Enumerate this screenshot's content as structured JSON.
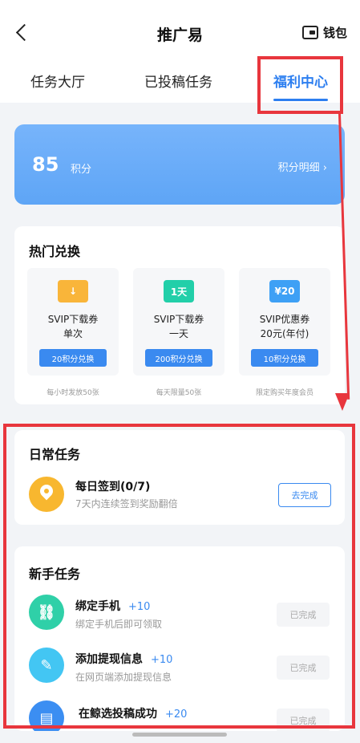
{
  "header": {
    "title": "推广易",
    "wallet_label": "钱包"
  },
  "tabs": [
    {
      "label": "任务大厅",
      "active": false
    },
    {
      "label": "已投稿任务",
      "active": false
    },
    {
      "label": "福利中心",
      "active": true
    }
  ],
  "points": {
    "value": "85",
    "unit": "积分",
    "detail_label": "积分明细 ›"
  },
  "hot_exchange": {
    "title": "热门兑换",
    "items": [
      {
        "icon": "download-coupon-icon",
        "icon_text": "↓",
        "icon_color": "#f9b53a",
        "name": "SVIP下载券",
        "sub": "单次",
        "button": "20积分兑换",
        "note": "每小时发放50张"
      },
      {
        "icon": "day-coupon-icon",
        "icon_text": "1天",
        "icon_color": "#22cfa9",
        "name": "SVIP下载券",
        "sub": "一天",
        "button": "200积分兑换",
        "note": "每天限量50张"
      },
      {
        "icon": "discount-coupon-icon",
        "icon_text": "¥20",
        "icon_color": "#3ea0f5",
        "name": "SVIP优惠券",
        "sub": "20元(年付)",
        "button": "10积分兑换",
        "note": "限定购买年度会员"
      }
    ]
  },
  "daily": {
    "title": "日常任务",
    "task": {
      "name": "每日签到(0/7)",
      "desc": "7天内连续签到奖励翻倍",
      "button": "去完成"
    }
  },
  "newbie": {
    "title": "新手任务",
    "tasks": [
      {
        "name": "绑定手机",
        "bonus": "+10",
        "desc": "绑定手机后即可领取",
        "button": "已完成",
        "icon": "link-phone-icon",
        "icon_color": "#2fd0a8"
      },
      {
        "name": "添加提现信息",
        "bonus": "+10",
        "desc": "在网页端添加提现信息",
        "button": "已完成",
        "icon": "edit-info-icon",
        "icon_color": "#43c6f3"
      },
      {
        "name": "在鲸选投稿成功",
        "bonus": "+20",
        "desc": "",
        "button": "已完成",
        "icon": "submit-file-icon",
        "icon_color": "#3b8ef2"
      }
    ]
  },
  "colors": {
    "accent": "#2d7ff0",
    "annotation_red": "#e8363d",
    "points_card": "#6aabf8"
  }
}
